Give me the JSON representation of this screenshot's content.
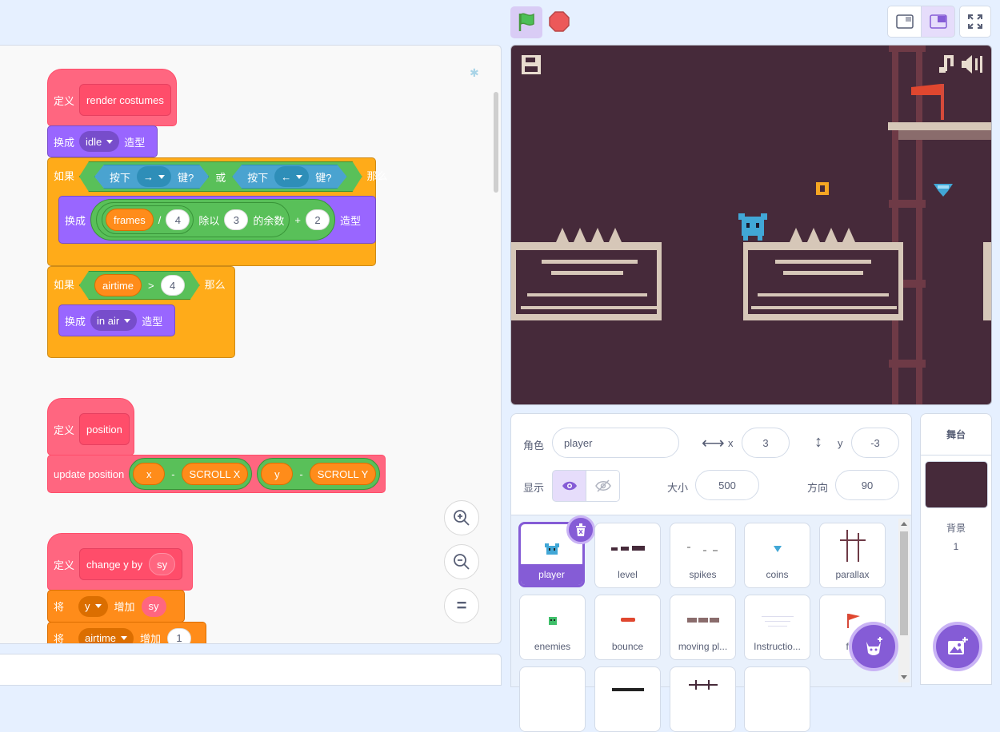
{
  "controls": {
    "green_flag": "green-flag",
    "stop": "stop-sign"
  },
  "layout_buttons": [
    "small-stage",
    "normal-stage",
    "fullscreen"
  ],
  "scripts": {
    "s1": {
      "define": "定义",
      "name": "render costumes",
      "switch1": "换成",
      "costume1": "idle",
      "costume_word": "造型",
      "if1": "如果",
      "key_pressed": "按下",
      "key_right": "→",
      "key_left": "←",
      "key_q": "键?",
      "or": "或",
      "then": "那么",
      "switch2": "换成",
      "frames": "frames",
      "div": "/",
      "four": "4",
      "mod_word": "除以",
      "three": "3",
      "remainder": "的余数",
      "plus": "+",
      "two": "2",
      "costume_word2": "造型",
      "if2": "如果",
      "airtime": "airtime",
      "gt": ">",
      "four2": "4",
      "then2": "那么",
      "switch3": "换成",
      "costume3": "in air",
      "costume_word3": "造型"
    },
    "s2": {
      "define": "定义",
      "name": "position",
      "call": "update position",
      "x": "x",
      "minus": "-",
      "scroll_x": "SCROLL X",
      "y": "y",
      "minus2": "-",
      "scroll_y": "SCROLL Y"
    },
    "s3": {
      "define": "定义",
      "name": "change y by",
      "param": "sy",
      "set1": "将",
      "var1": "y",
      "inc1": "增加",
      "val1": "sy",
      "set2": "将",
      "var2": "airtime",
      "inc2": "增加",
      "val2": "1"
    }
  },
  "zoom": {
    "in": "+",
    "out": "−",
    "reset": "="
  },
  "sprite_info": {
    "sprite_label": "角色",
    "sprite_name": "player",
    "x_label": "x",
    "x_value": "3",
    "y_label": "y",
    "y_value": "-3",
    "show_label": "显示",
    "size_label": "大小",
    "size_value": "500",
    "direction_label": "方向",
    "direction_value": "90"
  },
  "sprites": [
    {
      "name": "player",
      "selected": true
    },
    {
      "name": "level"
    },
    {
      "name": "spikes"
    },
    {
      "name": "coins"
    },
    {
      "name": "parallax"
    },
    {
      "name": "enemies"
    },
    {
      "name": "bounce"
    },
    {
      "name": "moving pl..."
    },
    {
      "name": "Instructio..."
    },
    {
      "name": "fl..."
    }
  ],
  "stage_panel": {
    "title": "舞台",
    "backdrop_label": "背景",
    "backdrop_count": "1"
  },
  "colors": {
    "accent": "#855cd6",
    "stage_bg": "#462a3a",
    "tile_light": "#d6c7b8"
  }
}
